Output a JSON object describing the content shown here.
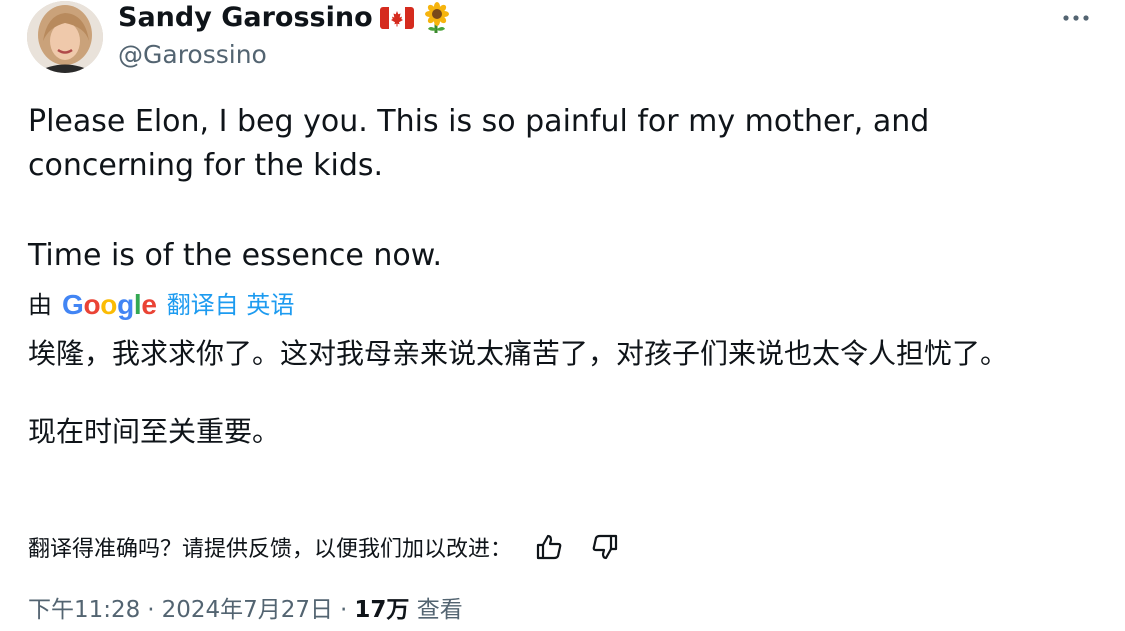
{
  "author": {
    "display_name": "Sandy Garossino",
    "name_emojis": [
      "canada-flag-icon",
      "sunflower-icon"
    ],
    "handle": "@Garossino"
  },
  "tweet": {
    "paragraph_1": "Please Elon, I beg you. This is so painful for my mother, and concerning for the kids.",
    "paragraph_2": "Time is of the essence now."
  },
  "translation": {
    "by_prefix": "由",
    "provider": "Google",
    "translated_from_label": "翻译自 英语",
    "paragraph_1": "埃隆，我求求你了。这对我母亲来说太痛苦了，对孩子们来说也太令人担忧了。",
    "paragraph_2": "现在时间至关重要。",
    "feedback_prompt": "翻译得准确吗？请提供反馈，以便我们加以改进："
  },
  "meta": {
    "time": "下午11:28",
    "separator": "·",
    "date": "2024年7月27日",
    "views_count": "17万",
    "views_label": "查看"
  },
  "colors": {
    "text_primary": "#0f1419",
    "text_secondary": "#536471",
    "link_blue": "#1d9bf0"
  }
}
